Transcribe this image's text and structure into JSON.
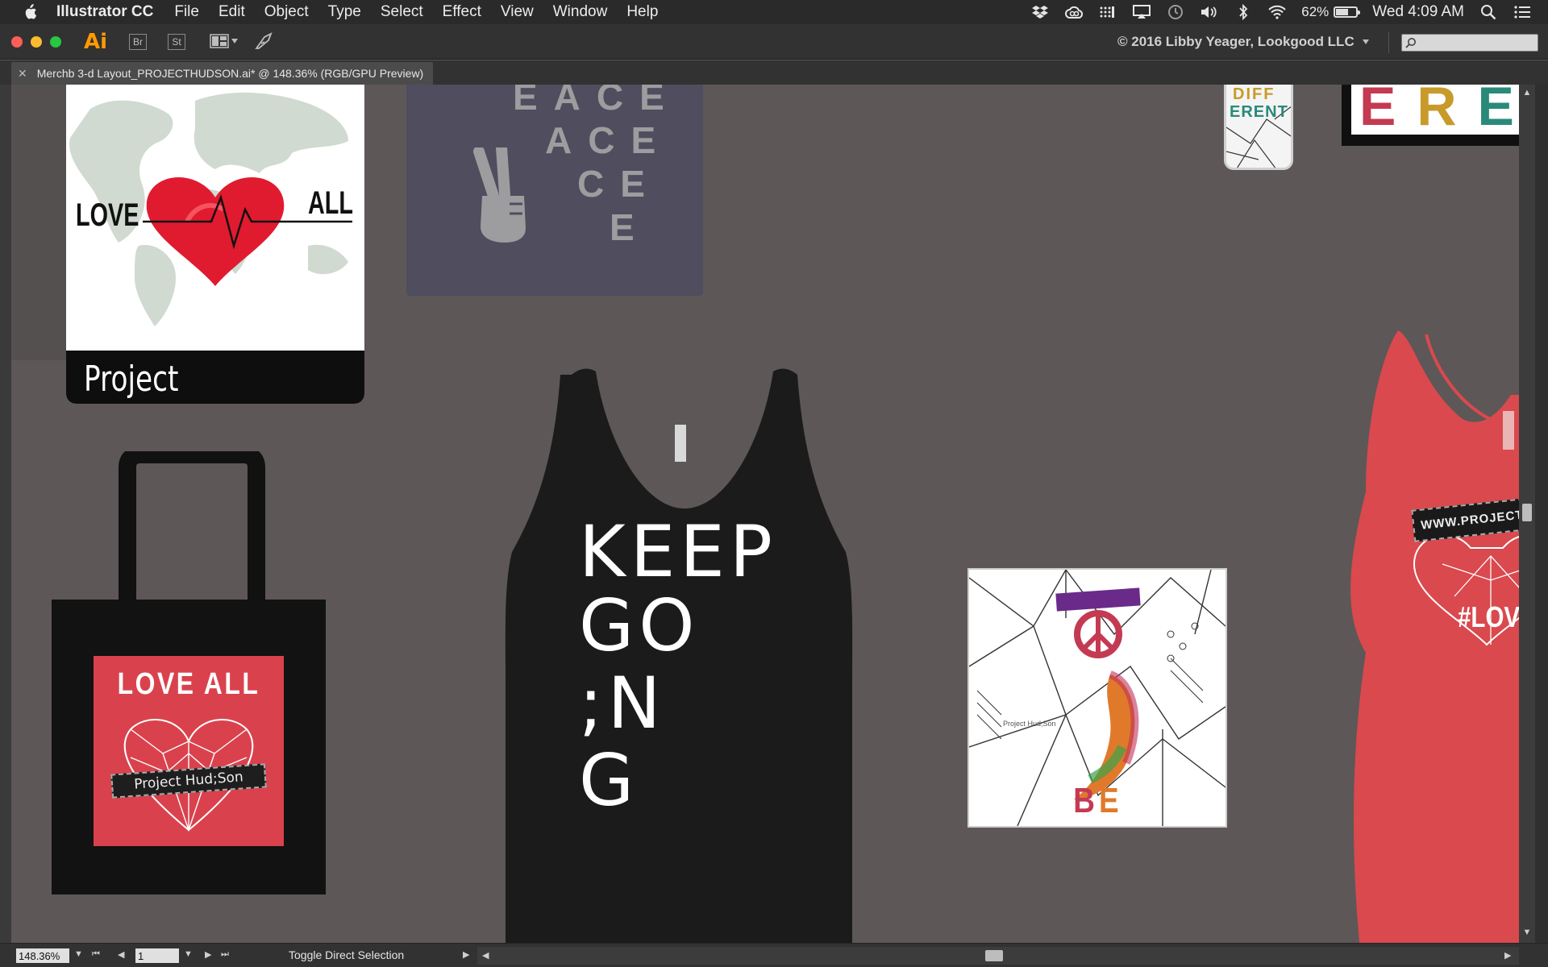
{
  "menubar": {
    "app_name": "Illustrator CC",
    "items": [
      "File",
      "Edit",
      "Object",
      "Type",
      "Select",
      "Effect",
      "View",
      "Window",
      "Help"
    ],
    "battery": "62%",
    "battery_level": 0.62,
    "clock": "Wed 4:09 AM"
  },
  "appbar": {
    "logo": "Ai",
    "buttons": [
      "Br",
      "St"
    ],
    "copyright": "© 2016 Libby Yeager, Lookgood LLC",
    "search_placeholder": ""
  },
  "document": {
    "tab_title": "Merchb 3-d Layout_PROJECTHUDSON.ai* @ 148.36% (RGB/GPU Preview)"
  },
  "artwork": {
    "love_all_print": {
      "left": "LOVE",
      "right": "ALL",
      "brand": "Project Hud;Son"
    },
    "peace_shirt": {
      "lines": [
        "EACE",
        "ACE",
        "CE",
        "E"
      ]
    },
    "phone_case": {
      "lines": [
        "DIFF",
        "ERENT"
      ]
    },
    "frame_top": {
      "text": "ERE"
    },
    "tote_bag": {
      "title": "LOVE ALL",
      "badge": "Project Hud;Son"
    },
    "tank_black": {
      "lines": [
        "KEEP",
        "GO",
        ";N",
        "G"
      ]
    },
    "tile": {
      "caption": "BE DIFFERENT",
      "brand": "Project Hud;Son"
    },
    "tank_red": {
      "badge": "WWW.PROJECTH",
      "hashtag": "#LOVE"
    }
  },
  "statusbar": {
    "zoom": "148.36%",
    "page": "1",
    "status": "Toggle Direct Selection"
  },
  "colors": {
    "canvas": "#5d5757",
    "accent_ai": "#ff9a00",
    "tote_red": "#d9424d",
    "tank_red": "#d9494e"
  }
}
